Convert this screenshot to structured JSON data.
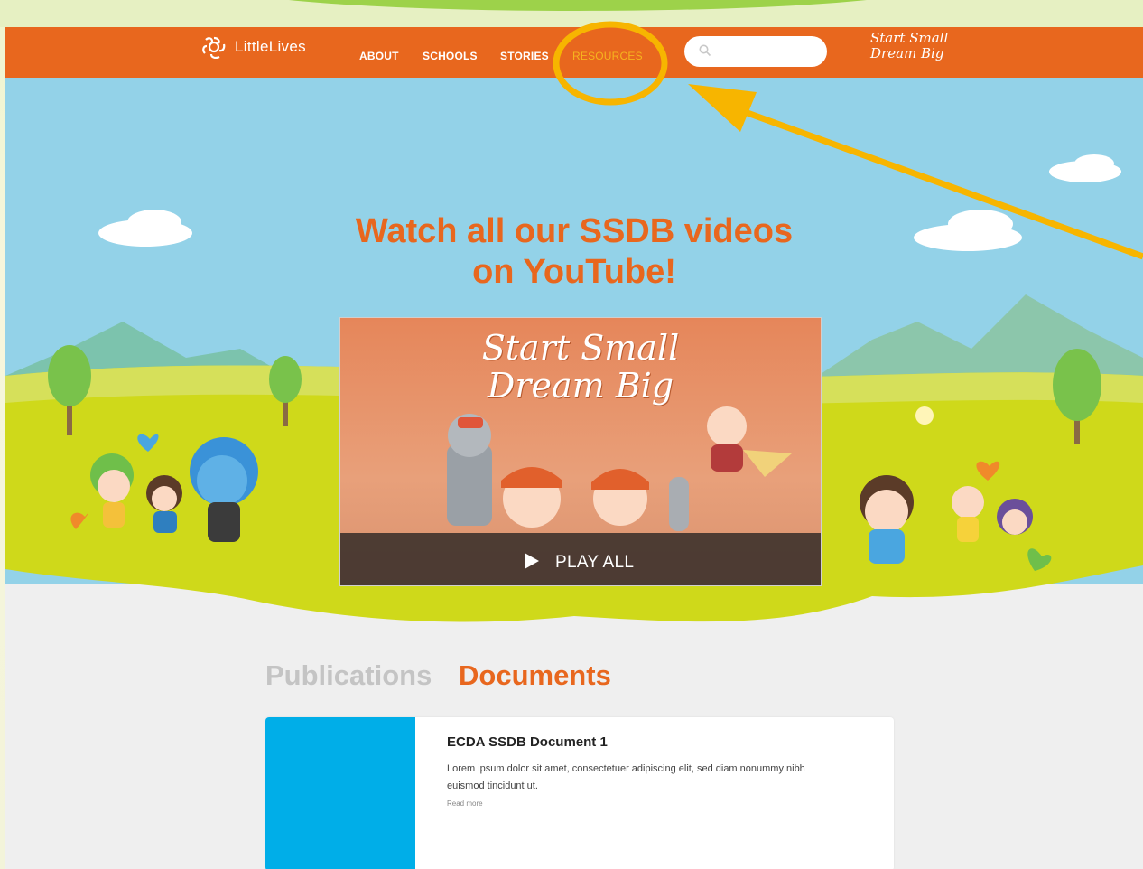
{
  "nav": {
    "logo_text": "LittleLives",
    "links": [
      "ABOUT",
      "SCHOOLS",
      "STORIES",
      "RESOURCES"
    ],
    "search_placeholder": "",
    "brand_line1": "Start Small",
    "brand_line2": "Dream Big"
  },
  "hero": {
    "title_line1": "Watch all our SSDB videos",
    "title_line2": "on YouTube!",
    "video_title_line1": "Start Small",
    "video_title_line2": "Dream Big",
    "play_label": "PLAY ALL"
  },
  "tabs": {
    "publications": "Publications",
    "documents": "Documents"
  },
  "card": {
    "title": "ECDA SSDB Document 1",
    "body": "Lorem ipsum dolor sit amet, consectetuer adipiscing elit, sed diam nonummy nibh euismod tincidunt ut.",
    "read_more": "Read more"
  },
  "colors": {
    "nav_bg": "#e8671e",
    "active_link": "#f6b41e",
    "title": "#e8671e",
    "thumb": "#00aee8",
    "annotation": "#f7b500"
  }
}
